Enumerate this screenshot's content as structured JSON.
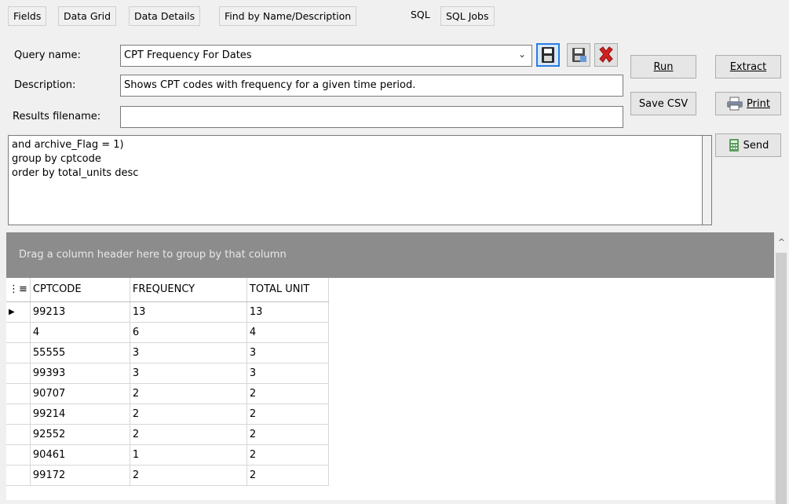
{
  "tabs": [
    {
      "label": "Fields"
    },
    {
      "label": "Data Grid"
    },
    {
      "label": "Data Details"
    },
    {
      "label": "Find by Name/Description"
    },
    {
      "label": "SQL"
    },
    {
      "label": "SQL Jobs"
    }
  ],
  "form": {
    "query_name_label": "Query name:",
    "query_name_value": "CPT Frequency For Dates",
    "description_label": "Description:",
    "description_value": "Shows CPT codes with frequency for a given time period.",
    "results_filename_label": "Results filename:",
    "results_filename_value": "",
    "sql_text": "and archive_Flag = 1)\ngroup by cptcode\norder by total_units desc"
  },
  "buttons": {
    "run": "Run",
    "extract": "Extract",
    "save_csv": "Save CSV",
    "print": "Print",
    "send": "Send"
  },
  "grid": {
    "group_panel_text": "Drag a column header here to group by that column",
    "columns": [
      "CPTCODE",
      "FREQUENCY",
      "TOTAL UNIT"
    ],
    "rows": [
      [
        "99213",
        "13",
        "13"
      ],
      [
        "4",
        "6",
        "4"
      ],
      [
        "55555",
        "3",
        "3"
      ],
      [
        "99393",
        "3",
        "3"
      ],
      [
        "90707",
        "2",
        "2"
      ],
      [
        "99214",
        "2",
        "2"
      ],
      [
        "92552",
        "2",
        "2"
      ],
      [
        "90461",
        "1",
        "2"
      ],
      [
        "99172",
        "2",
        "2"
      ]
    ],
    "selected_row": 0
  },
  "colors": {
    "group_panel_bg": "#8c8c8c",
    "accent": "#2a7de1",
    "delete_red": "#d42020"
  }
}
